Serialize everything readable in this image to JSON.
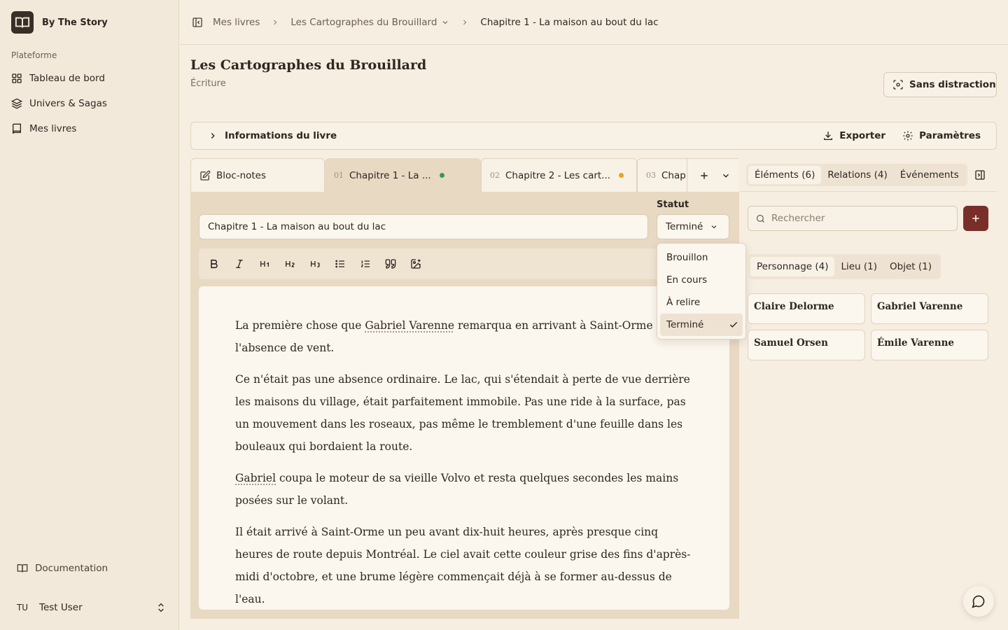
{
  "app": {
    "brand": "By The Story"
  },
  "sidebar": {
    "section": "Plateforme",
    "items": [
      {
        "label": "Tableau de bord",
        "icon": "grid-icon"
      },
      {
        "label": "Univers & Sagas",
        "icon": "layers-icon"
      },
      {
        "label": "Mes livres",
        "icon": "book-icon"
      }
    ],
    "documentation": "Documentation",
    "user": {
      "initials": "TU",
      "name": "Test User"
    }
  },
  "breadcrumb": {
    "root": "Mes livres",
    "book": "Les Cartographes du Brouillard",
    "chapter": "Chapitre 1 - La maison au bout du lac"
  },
  "header": {
    "title": "Les Cartographes du Brouillard",
    "subtitle": "Écriture",
    "focus_button": "Sans distraction"
  },
  "infobar": {
    "toggle_label": "Informations du livre",
    "export_label": "Exporter",
    "settings_label": "Paramètres"
  },
  "tabs": {
    "notes": "Bloc-notes",
    "chapters": [
      {
        "num": "01",
        "label": "Chapitre 1 - La ...",
        "status_color": "#2e9a5e"
      },
      {
        "num": "02",
        "label": "Chapitre 2 - Les cart...",
        "status_color": "#f0a020"
      },
      {
        "num": "03",
        "label": "Chap"
      }
    ]
  },
  "editor": {
    "chapter_title": "Chapitre 1 - La maison au bout du lac",
    "status_label": "Statut",
    "status_value": "Terminé",
    "status_options": [
      "Brouillon",
      "En cours",
      "À relire",
      "Terminé"
    ],
    "paragraphs": [
      {
        "before": "La première chose que ",
        "mention": "Gabriel Varenne",
        "after": " remarqua en arrivant à Saint-Orme fut l'absence de vent."
      },
      {
        "before": "Ce n'était pas une absence ordinaire. Le lac, qui s'étendait à perte de vue derrière les maisons du village, était parfaitement immobile. Pas une ride à la surface, pas un mouvement dans les roseaux, pas même le tremblement d'une feuille dans les bouleaux qui bordaient la route.",
        "mention": "",
        "after": ""
      },
      {
        "before": "",
        "mention": "Gabriel",
        "after": " coupa le moteur de sa vieille Volvo et resta quelques secondes les mains posées sur le volant."
      },
      {
        "before": "Il était arrivé à Saint-Orme un peu avant dix-huit heures, après presque cinq heures de route depuis Montréal. Le ciel avait cette couleur grise des fins d'après-midi d'octobre, et une brume légère commençait déjà à se former au-dessus de l'eau.",
        "mention": "",
        "after": ""
      }
    ]
  },
  "right_panel": {
    "tabs": [
      "Éléments (6)",
      "Relations (4)",
      "Événements"
    ],
    "search_placeholder": "Rechercher",
    "filters": [
      "Personnage (4)",
      "Lieu (1)",
      "Objet (1)"
    ],
    "cards": [
      "Claire Delorme",
      "Gabriel Varenne",
      "Samuel Orsen",
      "Émile Varenne"
    ]
  },
  "colors": {
    "accent": "#7a2e2a",
    "background": "#f6eee1",
    "status_done": "#2e9a5e",
    "status_in_progress": "#f0a020"
  }
}
